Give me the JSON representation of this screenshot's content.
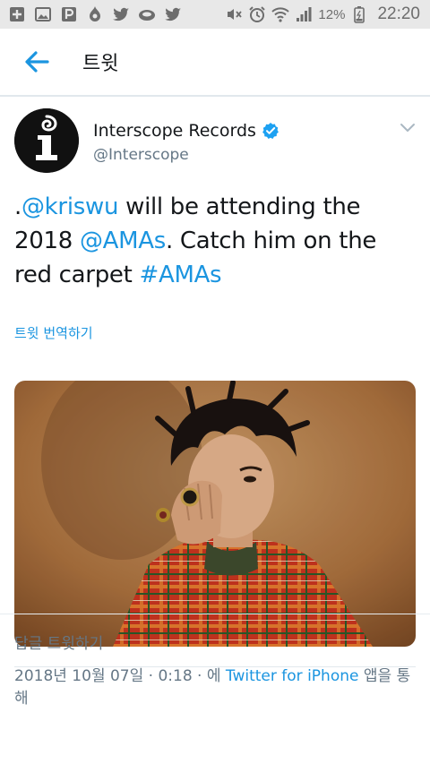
{
  "status_bar": {
    "battery_percent": "12%",
    "time": "22:20",
    "icons": [
      "plus-box-icon",
      "image-icon",
      "p-logo-icon",
      "fire-drop-icon",
      "twitter-bird-icon",
      "cloud-icon",
      "twitter-bird-icon",
      "mute-icon",
      "alarm-icon",
      "wifi-icon",
      "signal-icon",
      "battery-icon"
    ]
  },
  "header": {
    "title": "트윗",
    "back_icon": "arrow-left-icon"
  },
  "tweet": {
    "author_name": "Interscope Records",
    "author_handle": "@Interscope",
    "verified": true,
    "text_parts": {
      "p1": ".",
      "mention1": "@kriswu",
      "p2": " will be attending the 2018 ",
      "mention2": "@AMAs",
      "p3": ". Catch him on the red carpet ",
      "hashtag": "#AMAs"
    },
    "translate_label": "트윗 번역하기",
    "meta": {
      "datetime": "2018년 10월 07일 · 0:18 · 에 ",
      "source": "Twitter for iPhone",
      "suffix": " 앱을 통해"
    }
  },
  "reply": {
    "placeholder": "답글 트윗하기"
  },
  "colors": {
    "link": "#1b95e0",
    "secondary_text": "#657786",
    "primary_text": "#14171a",
    "status_bar_bg": "#e8e8e8",
    "verified_badge": "#1da1f2"
  }
}
